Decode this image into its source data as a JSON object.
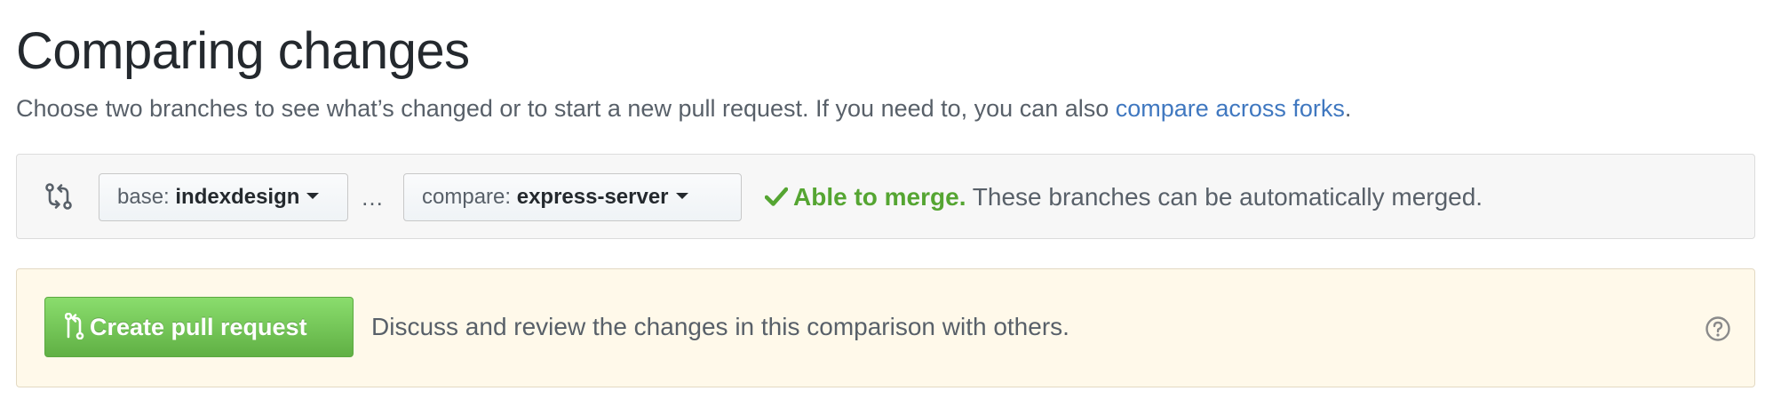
{
  "header": {
    "title": "Comparing changes",
    "subtitle_text": "Choose two branches to see what’s changed or to start a new pull request. If you need to, you can also ",
    "subtitle_link": "compare across forks",
    "subtitle_end": "."
  },
  "range": {
    "icon": "git-compare-icon",
    "base": {
      "prefix": "base:",
      "branch": "indexdesign"
    },
    "separator": "…",
    "compare": {
      "prefix": "compare:",
      "branch": "express-server"
    },
    "merge_status": {
      "icon": "check-icon",
      "status": "Able to merge.",
      "detail": "These branches can be automatically merged."
    }
  },
  "pull_request": {
    "button_icon": "git-pull-request-icon",
    "button_label": "Create pull request",
    "description": "Discuss and review the changes in this comparison with others.",
    "help_icon": "question-icon"
  },
  "colors": {
    "link": "#4078c0",
    "merge_ok": "#55a532",
    "create_button": "#6cc644",
    "pr_box_background": "#fff9ea",
    "range_box_background": "#f7f7f7"
  }
}
